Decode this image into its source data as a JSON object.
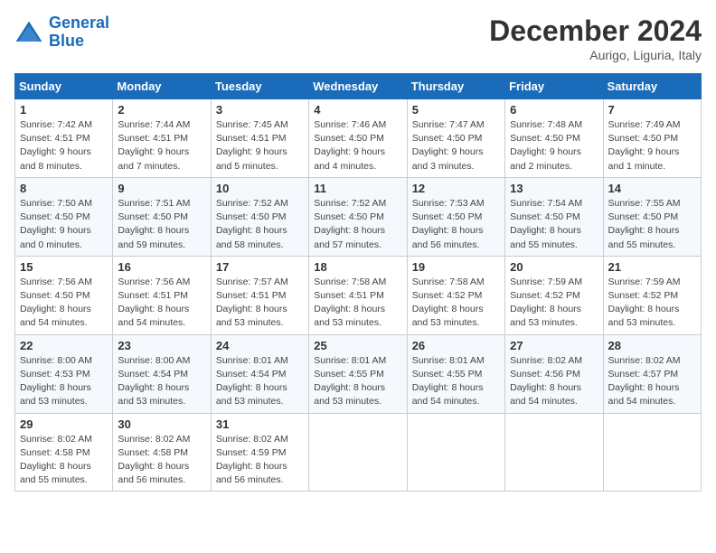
{
  "header": {
    "logo_line1": "General",
    "logo_line2": "Blue",
    "month": "December 2024",
    "location": "Aurigo, Liguria, Italy"
  },
  "weekdays": [
    "Sunday",
    "Monday",
    "Tuesday",
    "Wednesday",
    "Thursday",
    "Friday",
    "Saturday"
  ],
  "weeks": [
    [
      {
        "day": "1",
        "sunrise": "Sunrise: 7:42 AM",
        "sunset": "Sunset: 4:51 PM",
        "daylight": "Daylight: 9 hours and 8 minutes."
      },
      {
        "day": "2",
        "sunrise": "Sunrise: 7:44 AM",
        "sunset": "Sunset: 4:51 PM",
        "daylight": "Daylight: 9 hours and 7 minutes."
      },
      {
        "day": "3",
        "sunrise": "Sunrise: 7:45 AM",
        "sunset": "Sunset: 4:51 PM",
        "daylight": "Daylight: 9 hours and 5 minutes."
      },
      {
        "day": "4",
        "sunrise": "Sunrise: 7:46 AM",
        "sunset": "Sunset: 4:50 PM",
        "daylight": "Daylight: 9 hours and 4 minutes."
      },
      {
        "day": "5",
        "sunrise": "Sunrise: 7:47 AM",
        "sunset": "Sunset: 4:50 PM",
        "daylight": "Daylight: 9 hours and 3 minutes."
      },
      {
        "day": "6",
        "sunrise": "Sunrise: 7:48 AM",
        "sunset": "Sunset: 4:50 PM",
        "daylight": "Daylight: 9 hours and 2 minutes."
      },
      {
        "day": "7",
        "sunrise": "Sunrise: 7:49 AM",
        "sunset": "Sunset: 4:50 PM",
        "daylight": "Daylight: 9 hours and 1 minute."
      }
    ],
    [
      {
        "day": "8",
        "sunrise": "Sunrise: 7:50 AM",
        "sunset": "Sunset: 4:50 PM",
        "daylight": "Daylight: 9 hours and 0 minutes."
      },
      {
        "day": "9",
        "sunrise": "Sunrise: 7:51 AM",
        "sunset": "Sunset: 4:50 PM",
        "daylight": "Daylight: 8 hours and 59 minutes."
      },
      {
        "day": "10",
        "sunrise": "Sunrise: 7:52 AM",
        "sunset": "Sunset: 4:50 PM",
        "daylight": "Daylight: 8 hours and 58 minutes."
      },
      {
        "day": "11",
        "sunrise": "Sunrise: 7:52 AM",
        "sunset": "Sunset: 4:50 PM",
        "daylight": "Daylight: 8 hours and 57 minutes."
      },
      {
        "day": "12",
        "sunrise": "Sunrise: 7:53 AM",
        "sunset": "Sunset: 4:50 PM",
        "daylight": "Daylight: 8 hours and 56 minutes."
      },
      {
        "day": "13",
        "sunrise": "Sunrise: 7:54 AM",
        "sunset": "Sunset: 4:50 PM",
        "daylight": "Daylight: 8 hours and 55 minutes."
      },
      {
        "day": "14",
        "sunrise": "Sunrise: 7:55 AM",
        "sunset": "Sunset: 4:50 PM",
        "daylight": "Daylight: 8 hours and 55 minutes."
      }
    ],
    [
      {
        "day": "15",
        "sunrise": "Sunrise: 7:56 AM",
        "sunset": "Sunset: 4:50 PM",
        "daylight": "Daylight: 8 hours and 54 minutes."
      },
      {
        "day": "16",
        "sunrise": "Sunrise: 7:56 AM",
        "sunset": "Sunset: 4:51 PM",
        "daylight": "Daylight: 8 hours and 54 minutes."
      },
      {
        "day": "17",
        "sunrise": "Sunrise: 7:57 AM",
        "sunset": "Sunset: 4:51 PM",
        "daylight": "Daylight: 8 hours and 53 minutes."
      },
      {
        "day": "18",
        "sunrise": "Sunrise: 7:58 AM",
        "sunset": "Sunset: 4:51 PM",
        "daylight": "Daylight: 8 hours and 53 minutes."
      },
      {
        "day": "19",
        "sunrise": "Sunrise: 7:58 AM",
        "sunset": "Sunset: 4:52 PM",
        "daylight": "Daylight: 8 hours and 53 minutes."
      },
      {
        "day": "20",
        "sunrise": "Sunrise: 7:59 AM",
        "sunset": "Sunset: 4:52 PM",
        "daylight": "Daylight: 8 hours and 53 minutes."
      },
      {
        "day": "21",
        "sunrise": "Sunrise: 7:59 AM",
        "sunset": "Sunset: 4:52 PM",
        "daylight": "Daylight: 8 hours and 53 minutes."
      }
    ],
    [
      {
        "day": "22",
        "sunrise": "Sunrise: 8:00 AM",
        "sunset": "Sunset: 4:53 PM",
        "daylight": "Daylight: 8 hours and 53 minutes."
      },
      {
        "day": "23",
        "sunrise": "Sunrise: 8:00 AM",
        "sunset": "Sunset: 4:54 PM",
        "daylight": "Daylight: 8 hours and 53 minutes."
      },
      {
        "day": "24",
        "sunrise": "Sunrise: 8:01 AM",
        "sunset": "Sunset: 4:54 PM",
        "daylight": "Daylight: 8 hours and 53 minutes."
      },
      {
        "day": "25",
        "sunrise": "Sunrise: 8:01 AM",
        "sunset": "Sunset: 4:55 PM",
        "daylight": "Daylight: 8 hours and 53 minutes."
      },
      {
        "day": "26",
        "sunrise": "Sunrise: 8:01 AM",
        "sunset": "Sunset: 4:55 PM",
        "daylight": "Daylight: 8 hours and 54 minutes."
      },
      {
        "day": "27",
        "sunrise": "Sunrise: 8:02 AM",
        "sunset": "Sunset: 4:56 PM",
        "daylight": "Daylight: 8 hours and 54 minutes."
      },
      {
        "day": "28",
        "sunrise": "Sunrise: 8:02 AM",
        "sunset": "Sunset: 4:57 PM",
        "daylight": "Daylight: 8 hours and 54 minutes."
      }
    ],
    [
      {
        "day": "29",
        "sunrise": "Sunrise: 8:02 AM",
        "sunset": "Sunset: 4:58 PM",
        "daylight": "Daylight: 8 hours and 55 minutes."
      },
      {
        "day": "30",
        "sunrise": "Sunrise: 8:02 AM",
        "sunset": "Sunset: 4:58 PM",
        "daylight": "Daylight: 8 hours and 56 minutes."
      },
      {
        "day": "31",
        "sunrise": "Sunrise: 8:02 AM",
        "sunset": "Sunset: 4:59 PM",
        "daylight": "Daylight: 8 hours and 56 minutes."
      },
      null,
      null,
      null,
      null
    ]
  ]
}
